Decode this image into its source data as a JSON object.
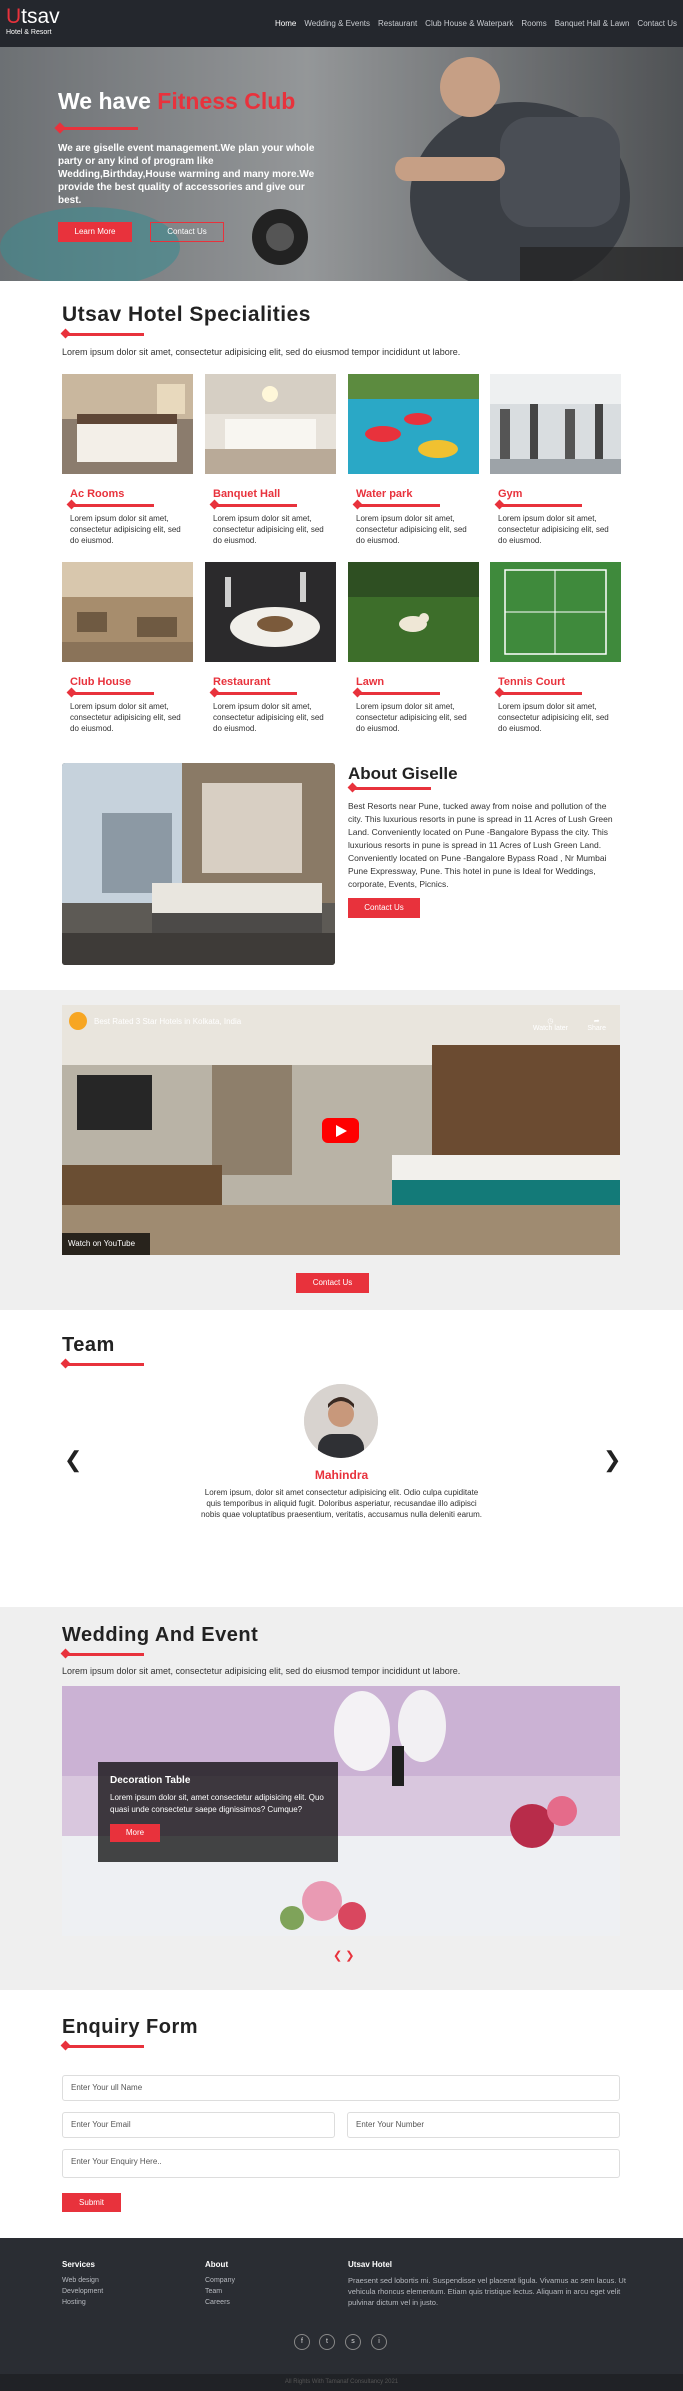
{
  "brand": {
    "initial": "U",
    "rest": "tsav",
    "tagline": "Hotel & Resort"
  },
  "nav": [
    "Home",
    "Wedding & Events",
    "Restaurant",
    "Club House & Waterpark",
    "Rooms",
    "Banquet Hall & Lawn",
    "Contact Us"
  ],
  "hero": {
    "title_plain": "We have",
    "title_accent": "Fitness Club",
    "text": "We are giselle event management.We plan your whole party or any kind of program like Wedding,Birthday,House warming and many more.We provide the best quality of accessories and give our best.",
    "btn_learn": "Learn More",
    "btn_contact": "Contact Us"
  },
  "specialities": {
    "title": "Utsav Hotel Specialities",
    "subtitle": "Lorem ipsum dolor sit amet, consectetur adipisicing elit, sed do eiusmod tempor incididunt ut labore.",
    "items": [
      {
        "title": "Ac Rooms",
        "desc": "Lorem ipsum dolor sit amet, consectetur adipisicing elit, sed do eiusmod."
      },
      {
        "title": "Banquet Hall",
        "desc": "Lorem ipsum dolor sit amet, consectetur adipisicing elit, sed do eiusmod."
      },
      {
        "title": "Water park",
        "desc": "Lorem ipsum dolor sit amet, consectetur adipisicing elit, sed do eiusmod."
      },
      {
        "title": "Gym",
        "desc": "Lorem ipsum dolor sit amet, consectetur adipisicing elit, sed do eiusmod."
      },
      {
        "title": "Club House",
        "desc": "Lorem ipsum dolor sit amet, consectetur adipisicing elit, sed do eiusmod."
      },
      {
        "title": "Restaurant",
        "desc": "Lorem ipsum dolor sit amet, consectetur adipisicing elit, sed do eiusmod."
      },
      {
        "title": "Lawn",
        "desc": "Lorem ipsum dolor sit amet, consectetur adipisicing elit, sed do eiusmod."
      },
      {
        "title": "Tennis Court",
        "desc": "Lorem ipsum dolor sit amet, consectetur adipisicing elit, sed do eiusmod."
      }
    ]
  },
  "about": {
    "title": "About Giselle",
    "text": "Best Resorts near Pune, tucked away from noise and pollution of the city. This luxurious resorts in pune is spread in 11 Acres of Lush Green Land. Conveniently located on Pune -Bangalore Bypass the city. This luxurious resorts in pune is spread in 11 Acres of Lush Green Land. Conveniently located on Pune -Bangalore Bypass Road , Nr Mumbai Pune Expressway, Pune. This hotel in pune is Ideal for Weddings, corporate, Events, Picnics.",
    "button": "Contact Us"
  },
  "video": {
    "title": "Best Rated 3 Star Hotels in Kolkata, India",
    "watch_later": "Watch later",
    "share": "Share",
    "watch_on": "Watch on YouTube",
    "button": "Contact Us"
  },
  "team": {
    "title": "Team",
    "name": "Mahindra",
    "text": "Lorem ipsum, dolor sit amet consectetur adipisicing elit. Odio culpa cupiditate quis temporibus in aliquid fugit. Doloribus asperiatur, recusandae illo adipisci nobis quae voluptatibus praesentium, veritatis, accusamus nulla deleniti earum.",
    "prev": "❮",
    "next": "❯"
  },
  "wedding": {
    "title": "Wedding And Event",
    "subtitle": "Lorem ipsum dolor sit amet, consectetur adipisicing elit, sed do eiusmod tempor incididunt ut labore.",
    "slide_title": "Decoration Table",
    "slide_text": "Lorem ipsum dolor sit, amet consectetur adipisicing elit. Quo quasi unde consectetur saepe dignissimos? Cumque?",
    "slide_button": "More",
    "nav": "❮ ❯"
  },
  "enquiry": {
    "title": "Enquiry Form",
    "name_placeholder": "Enter Your ull Name",
    "email_placeholder": "Enter Your Email",
    "number_placeholder": "Enter Your Number",
    "message_placeholder": "Enter Your Enquiry Here..",
    "submit": "Submit"
  },
  "footer": {
    "services_title": "Services",
    "services": [
      "Web design",
      "Development",
      "Hosting"
    ],
    "about_title": "About",
    "about": [
      "Company",
      "Team",
      "Careers"
    ],
    "hotel_title": "Utsav Hotel",
    "hotel_text": "Praesent sed lobortis mi. Suspendisse vel placerat ligula. Vivamus ac sem lacus. Ut vehicula rhoncus elementum. Etiam quis tristique lectus. Aliquam in arcu eget velit pulvinar dictum vel in justo.",
    "social": [
      "f",
      "t",
      "s",
      "i"
    ],
    "copyright": "All Rights With Tamanaf Consultancy 2021"
  }
}
